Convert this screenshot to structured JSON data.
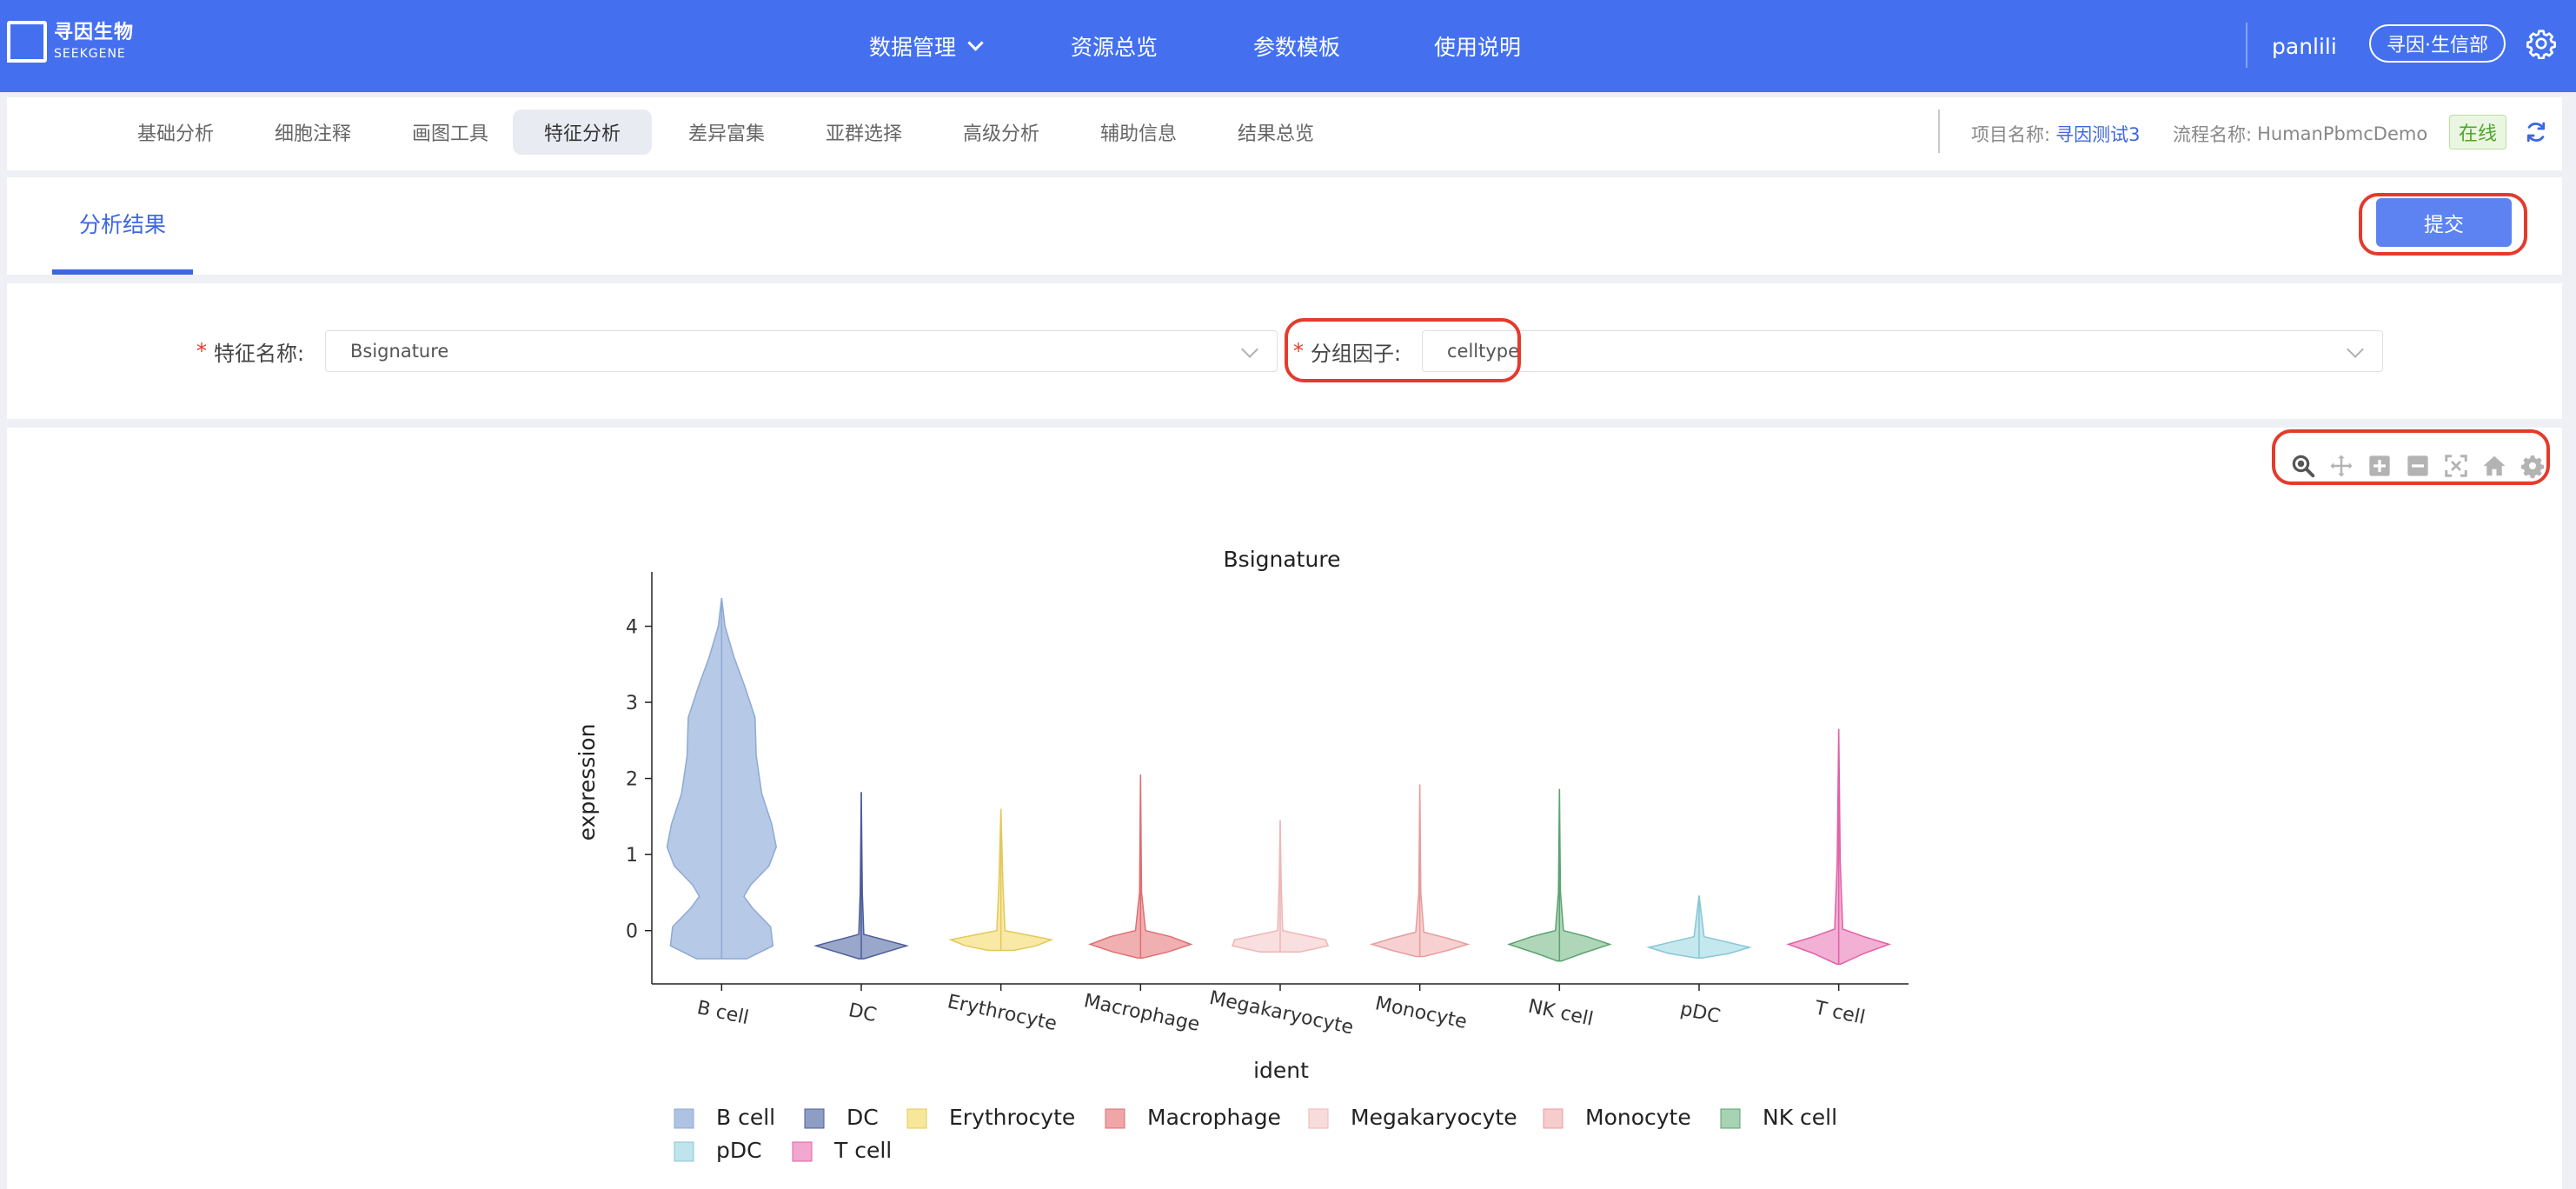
{
  "header": {
    "logo_cn": "寻因生物",
    "logo_en": "SEEKGENE",
    "menu": [
      {
        "label": "数据管理"
      },
      {
        "label": "资源总览"
      },
      {
        "label": "参数模板"
      },
      {
        "label": "使用说明"
      }
    ],
    "user": "panlili",
    "org": "寻因·生信部"
  },
  "subnav": {
    "tabs": [
      {
        "label": "基础分析"
      },
      {
        "label": "细胞注释"
      },
      {
        "label": "画图工具"
      },
      {
        "label": "特征分析",
        "active": true
      },
      {
        "label": "差异富集"
      },
      {
        "label": "亚群选择"
      },
      {
        "label": "高级分析"
      },
      {
        "label": "辅助信息"
      },
      {
        "label": "结果总览"
      }
    ],
    "project_label": "项目名称:",
    "project_value": "寻因测试3",
    "flow_label": "流程名称:",
    "flow_value": "HumanPbmcDemo",
    "status": "在线"
  },
  "result": {
    "tab_label": "分析结果",
    "submit_label": "提交"
  },
  "form": {
    "feature_label": "特征名称:",
    "feature_value": "Bsignature",
    "group_label": "分组因子:",
    "group_value": "celltype"
  },
  "toolbar_icons": [
    "zoom-icon",
    "pan-icon",
    "zoom-in-icon",
    "zoom-out-icon",
    "autoscale-icon",
    "home-icon",
    "settings-icon"
  ],
  "chart_data": {
    "type": "violin",
    "title": "Bsignature",
    "xlabel": "ident",
    "ylabel": "expression",
    "ylim": [
      -0.7,
      4.6
    ],
    "yticks": [
      0,
      1,
      2,
      3,
      4
    ],
    "legend_position": "bottom",
    "categories": [
      "B cell",
      "DC",
      "Erythrocyte",
      "Macrophage",
      "Megakaryocyte",
      "Monocyte",
      "NK cell",
      "pDC",
      "T cell"
    ],
    "series": [
      {
        "name": "B cell",
        "color": "#aec3e3",
        "stroke": "#8fa9d6",
        "min": -0.37,
        "max": 4.37,
        "shape": [
          [
            -0.37,
            0.45
          ],
          [
            -0.2,
            0.92
          ],
          [
            0.05,
            0.88
          ],
          [
            0.3,
            0.55
          ],
          [
            0.45,
            0.4
          ],
          [
            0.6,
            0.52
          ],
          [
            0.85,
            0.85
          ],
          [
            1.1,
            0.98
          ],
          [
            1.4,
            0.9
          ],
          [
            1.8,
            0.72
          ],
          [
            2.3,
            0.62
          ],
          [
            2.8,
            0.6
          ],
          [
            3.2,
            0.42
          ],
          [
            3.6,
            0.22
          ],
          [
            4.0,
            0.06
          ],
          [
            4.37,
            0.0
          ]
        ]
      },
      {
        "name": "DC",
        "color": "#8e9dc4",
        "stroke": "#4c5d99",
        "min": -0.37,
        "max": 1.82,
        "shape": [
          [
            -0.37,
            0.05
          ],
          [
            -0.28,
            0.5
          ],
          [
            -0.2,
            0.9
          ],
          [
            -0.12,
            0.45
          ],
          [
            -0.05,
            0.05
          ],
          [
            0.5,
            0.02
          ],
          [
            1.82,
            0.0
          ]
        ]
      },
      {
        "name": "Erythrocyte",
        "color": "#f7e79b",
        "stroke": "#e3c85a",
        "min": -0.26,
        "max": 1.6,
        "shape": [
          [
            -0.26,
            0.25
          ],
          [
            -0.2,
            0.7
          ],
          [
            -0.12,
            1.0
          ],
          [
            -0.06,
            0.55
          ],
          [
            0.0,
            0.08
          ],
          [
            0.6,
            0.04
          ],
          [
            1.6,
            0.0
          ]
        ]
      },
      {
        "name": "Macrophage",
        "color": "#eea6a8",
        "stroke": "#df6f72",
        "min": -0.36,
        "max": 2.05,
        "shape": [
          [
            -0.36,
            0.05
          ],
          [
            -0.28,
            0.55
          ],
          [
            -0.18,
            1.0
          ],
          [
            -0.08,
            0.6
          ],
          [
            0.0,
            0.1
          ],
          [
            0.5,
            0.02
          ],
          [
            2.05,
            0.0
          ]
        ]
      },
      {
        "name": "Megakaryocyte",
        "color": "#f8dcdc",
        "stroke": "#efb6b6",
        "min": -0.28,
        "max": 1.45,
        "shape": [
          [
            -0.28,
            0.4
          ],
          [
            -0.2,
            0.95
          ],
          [
            -0.12,
            0.9
          ],
          [
            -0.05,
            0.4
          ],
          [
            0.0,
            0.05
          ],
          [
            0.6,
            0.02
          ],
          [
            1.45,
            0.0
          ]
        ]
      },
      {
        "name": "Monocyte",
        "color": "#f6cccc",
        "stroke": "#e79d9d",
        "min": -0.34,
        "max": 1.92,
        "shape": [
          [
            -0.34,
            0.08
          ],
          [
            -0.26,
            0.55
          ],
          [
            -0.18,
            0.95
          ],
          [
            -0.1,
            0.55
          ],
          [
            -0.02,
            0.08
          ],
          [
            0.5,
            0.02
          ],
          [
            1.92,
            0.0
          ]
        ]
      },
      {
        "name": "NK cell",
        "color": "#a7d2b3",
        "stroke": "#5ba36e",
        "min": -0.4,
        "max": 1.86,
        "shape": [
          [
            -0.4,
            0.04
          ],
          [
            -0.3,
            0.45
          ],
          [
            -0.18,
            1.0
          ],
          [
            -0.08,
            0.55
          ],
          [
            0.0,
            0.08
          ],
          [
            0.5,
            0.02
          ],
          [
            1.86,
            0.0
          ]
        ]
      },
      {
        "name": "pDC",
        "color": "#bfe4ec",
        "stroke": "#88c6d6",
        "min": -0.36,
        "max": 0.46,
        "shape": [
          [
            -0.36,
            0.05
          ],
          [
            -0.3,
            0.6
          ],
          [
            -0.22,
            1.0
          ],
          [
            -0.15,
            0.55
          ],
          [
            -0.08,
            0.1
          ],
          [
            0.46,
            0.0
          ]
        ]
      },
      {
        "name": "T cell",
        "color": "#f1a7cf",
        "stroke": "#e061a7",
        "min": -0.44,
        "max": 2.65,
        "shape": [
          [
            -0.44,
            0.04
          ],
          [
            -0.3,
            0.5
          ],
          [
            -0.18,
            1.0
          ],
          [
            -0.08,
            0.5
          ],
          [
            0.02,
            0.08
          ],
          [
            0.9,
            0.03
          ],
          [
            2.65,
            0.0
          ]
        ]
      }
    ]
  }
}
